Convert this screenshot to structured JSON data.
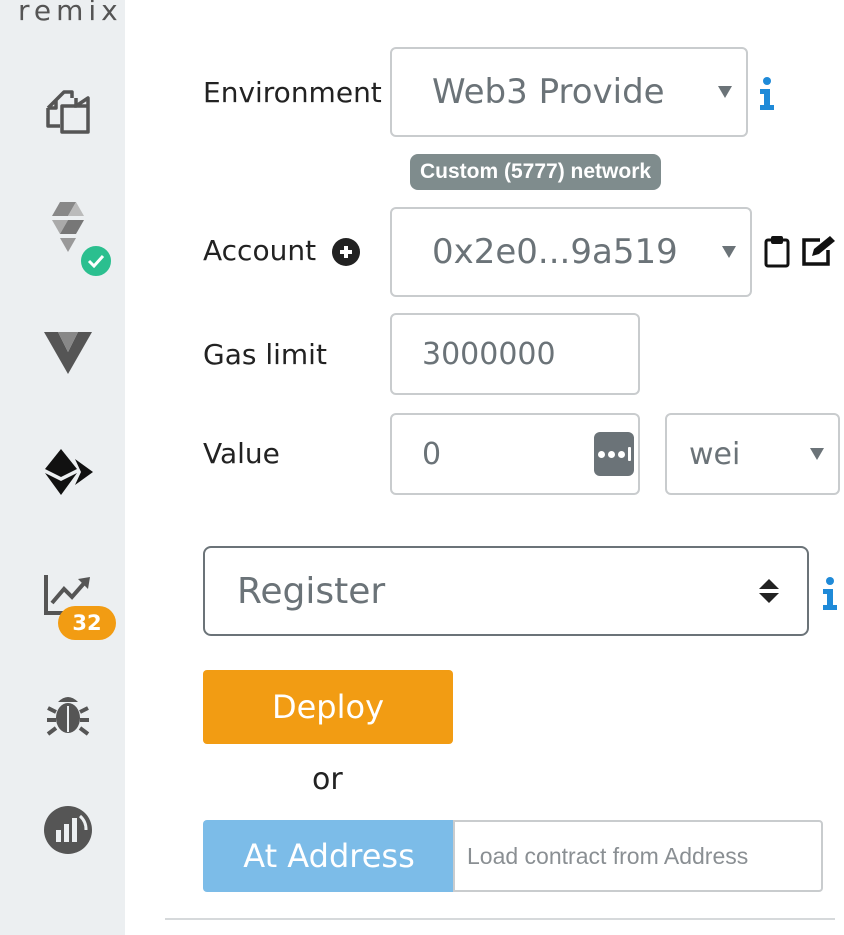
{
  "sidebar": {
    "logo": "remix",
    "icons": [
      "file-explorer-icon",
      "solidity-compiler-icon",
      "vyper-icon",
      "deploy-run-icon",
      "analysis-icon",
      "debugger-icon",
      "gas-profiler-icon",
      "settings-icon"
    ],
    "compiler_status": "success",
    "analysis_badge": "32",
    "colors": {
      "sidebar_bg": "#eceff1",
      "check_badge": "#2bbf8f",
      "count_badge": "#f29c13"
    }
  },
  "environment": {
    "label": "Environment",
    "selected": "Web3 Provide",
    "network": "Custom (5777) network"
  },
  "account": {
    "label": "Account",
    "selected": "0x2e0...9a519"
  },
  "gas": {
    "label": "Gas limit",
    "value": "3000000"
  },
  "value": {
    "label": "Value",
    "amount": "0",
    "unit": "wei"
  },
  "contract": {
    "selected": "Register"
  },
  "actions": {
    "deploy_label": "Deploy",
    "or_label": "or",
    "at_address_label": "At Address",
    "at_address_placeholder": "Load contract from Address"
  },
  "colors": {
    "deploy": "#f29c13",
    "at_address": "#7cbce8",
    "info": "#1f8ad8",
    "network_pill": "#7f8c8d"
  }
}
